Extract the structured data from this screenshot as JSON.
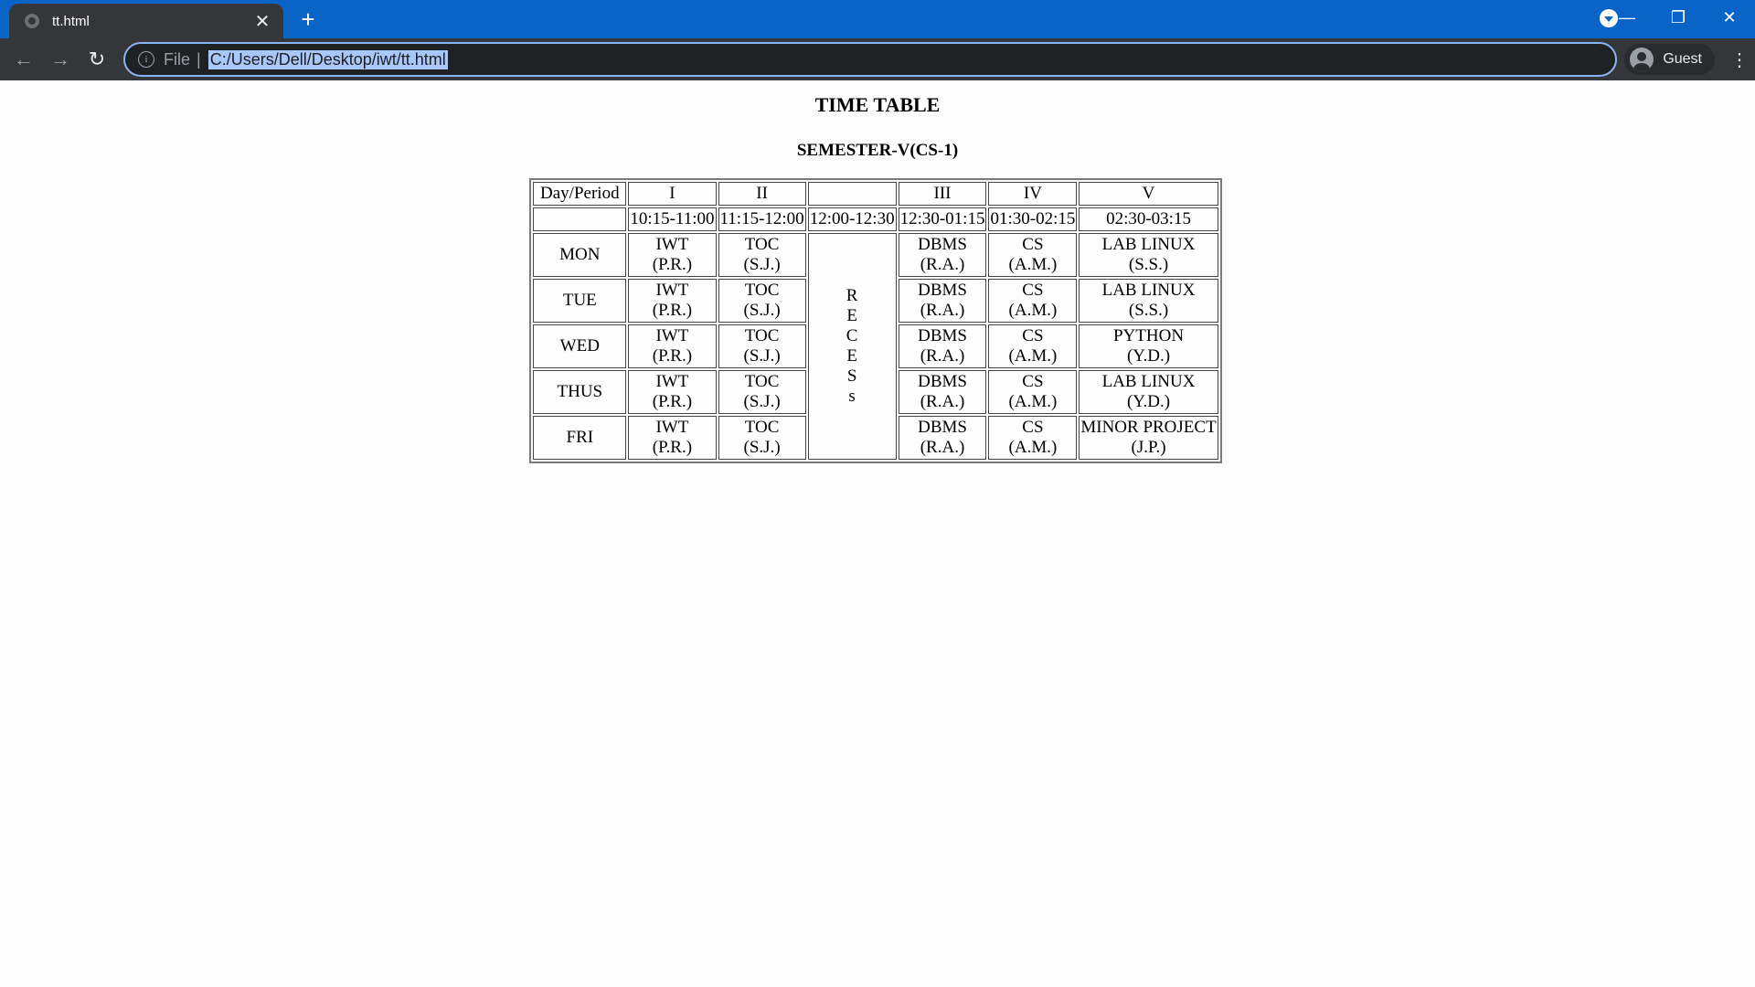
{
  "browser": {
    "tab_title": "tt.html",
    "tab_close": "✕",
    "new_tab": "+",
    "scheme": "File",
    "separator": "|",
    "url": "C:/Users/Dell/Desktop/iwt/tt.html",
    "profile": "Guest",
    "window_controls": {
      "minimize": "—",
      "restore": "❐",
      "close": "✕"
    }
  },
  "page": {
    "title": "TIME TABLE",
    "subtitle": "SEMESTER-V(CS-1)"
  },
  "timetable": {
    "header": [
      "Day/Period",
      "I",
      "II",
      "",
      "III",
      "IV",
      "V"
    ],
    "times": [
      "",
      "10:15-11:00",
      "11:15-12:00",
      "12:00-12:30",
      "12:30-01:15",
      "01:30-02:15",
      "02:30-03:15"
    ],
    "recess_letters": [
      "R",
      "E",
      "C",
      "E",
      "S",
      "s"
    ],
    "rows": [
      {
        "day": "MON",
        "p1": [
          "IWT",
          "(P.R.)"
        ],
        "p2": [
          "TOC",
          "(S.J.)"
        ],
        "p3": [
          "DBMS",
          "(R.A.)"
        ],
        "p4": [
          "CS",
          "(A.M.)"
        ],
        "p5": [
          "LAB LINUX",
          "(S.S.)"
        ]
      },
      {
        "day": "TUE",
        "p1": [
          "IWT",
          "(P.R.)"
        ],
        "p2": [
          "TOC",
          "(S.J.)"
        ],
        "p3": [
          "DBMS",
          "(R.A.)"
        ],
        "p4": [
          "CS",
          "(A.M.)"
        ],
        "p5": [
          "LAB LINUX",
          "(S.S.)"
        ]
      },
      {
        "day": "WED",
        "p1": [
          "IWT",
          "(P.R.)"
        ],
        "p2": [
          "TOC",
          "(S.J.)"
        ],
        "p3": [
          "DBMS",
          "(R.A.)"
        ],
        "p4": [
          "CS",
          "(A.M.)"
        ],
        "p5": [
          "PYTHON",
          "(Y.D.)"
        ]
      },
      {
        "day": "THUS",
        "p1": [
          "IWT",
          "(P.R.)"
        ],
        "p2": [
          "TOC",
          "(S.J.)"
        ],
        "p3": [
          "DBMS",
          "(R.A.)"
        ],
        "p4": [
          "CS",
          "(A.M.)"
        ],
        "p5": [
          "LAB LINUX",
          "(Y.D.)"
        ]
      },
      {
        "day": "FRI",
        "p1": [
          "IWT",
          "(P.R.)"
        ],
        "p2": [
          "TOC",
          "(S.J.)"
        ],
        "p3": [
          "DBMS",
          "(R.A.)"
        ],
        "p4": [
          "CS",
          "(A.M.)"
        ],
        "p5": [
          "MINOR PROJECT",
          "(J.P.)"
        ]
      }
    ]
  }
}
